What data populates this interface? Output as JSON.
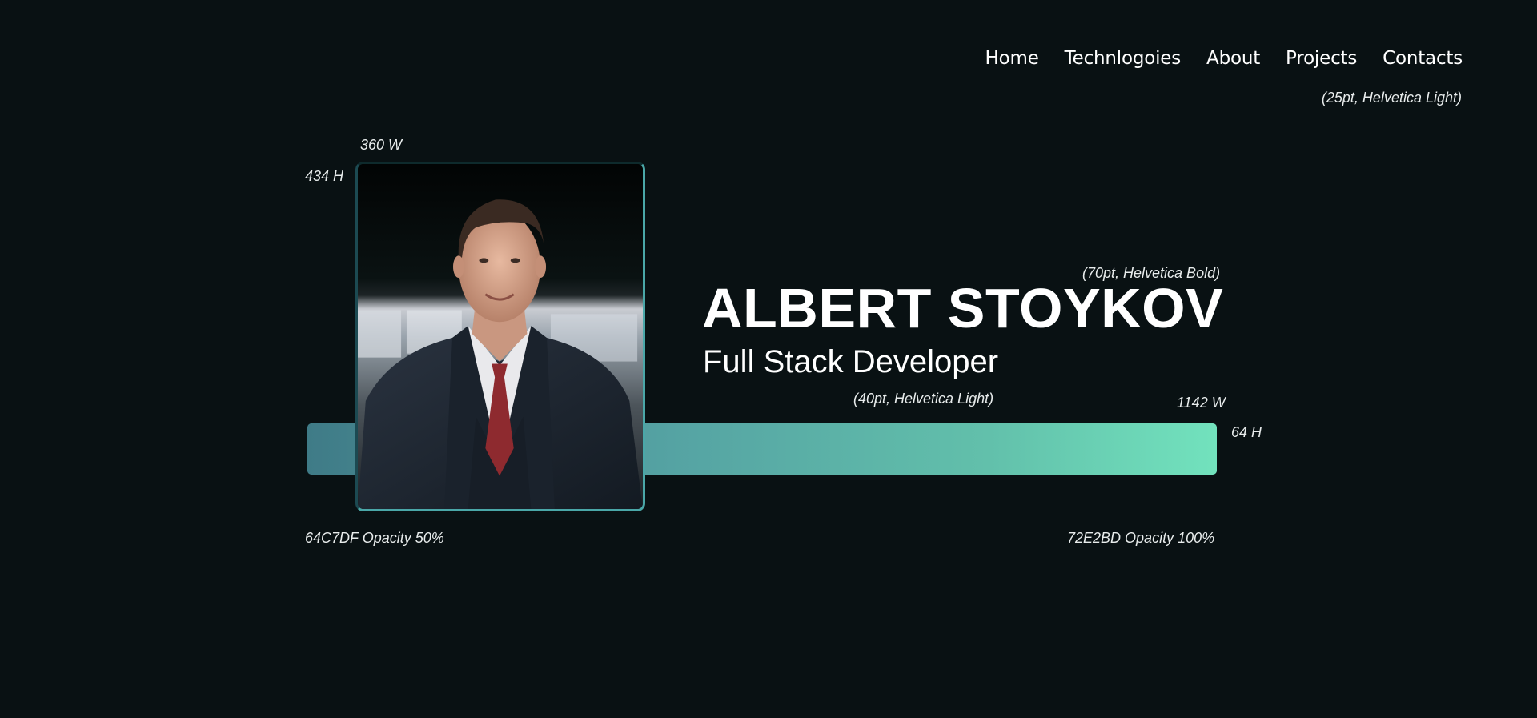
{
  "nav": {
    "items": [
      {
        "label": "Home"
      },
      {
        "label": "Technlogoies"
      },
      {
        "label": "About"
      },
      {
        "label": "Projects"
      },
      {
        "label": "Contacts"
      }
    ],
    "font_note": "(25pt, Helvetica Light)"
  },
  "hero": {
    "name": "ALBERT STOYKOV",
    "role": "Full Stack Developer",
    "name_font_note": "(70pt, Helvetica Bold)",
    "role_font_note": "(40pt, Helvetica Light)"
  },
  "photo": {
    "width_note": "360 W",
    "height_note": "434 H"
  },
  "bar": {
    "width_note": "1142 W",
    "height_note": "64 H",
    "start_color_note": "64C7DF Opacity 50%",
    "end_color_note": "72E2BD Opacity 100%",
    "start_color": "#64C7DF",
    "end_color": "#72E2BD"
  },
  "colors": {
    "background": "#091113",
    "text": "#ffffff"
  }
}
